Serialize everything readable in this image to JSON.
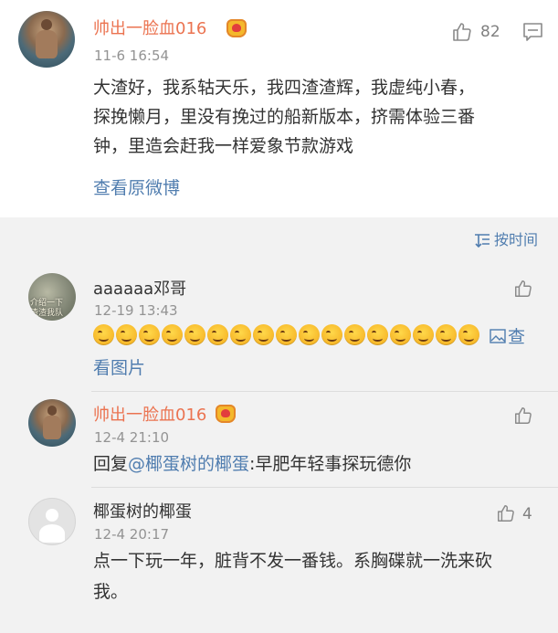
{
  "main_post": {
    "author": "帅出一脸血016",
    "time": "11-6 16:54",
    "likes": "82",
    "body_line1": "大渣好，我系轱天乐，我四渣渣辉，我虚纯小春，",
    "body_line2": "探挽懒月，里没有挽过的船新版本，挤需体验三番",
    "body_line3": "钟，里造会赶我一样爱象节款游戏",
    "view_original": "查看原微博"
  },
  "sort": {
    "label": "按时间"
  },
  "comments": [
    {
      "author": "aaaaaa邓哥",
      "time": "12-19 13:43",
      "avatar_text": "介绍一下\n渣渣我队\n",
      "emoji_count": 17,
      "view_image_part1": "查",
      "view_image_part2": "看图片"
    },
    {
      "author": "帅出一脸血016",
      "time": "12-4 21:10",
      "reply_prefix": "回复",
      "mention": "@椰蛋树的椰蛋",
      "reply_text": ":早肥年轻事探玩德你"
    },
    {
      "author": "椰蛋树的椰蛋",
      "time": "12-4 20:17",
      "likes": "4",
      "text_line1": "点一下玩一年，脏背不发一番钱。系胸碟就一洗来砍",
      "text_line2": "我。"
    }
  ],
  "colors": {
    "vip_name": "#eb7350",
    "link": "#507daf",
    "text": "#333333",
    "meta": "#939393",
    "panel_bg": "#f2f2f2"
  }
}
